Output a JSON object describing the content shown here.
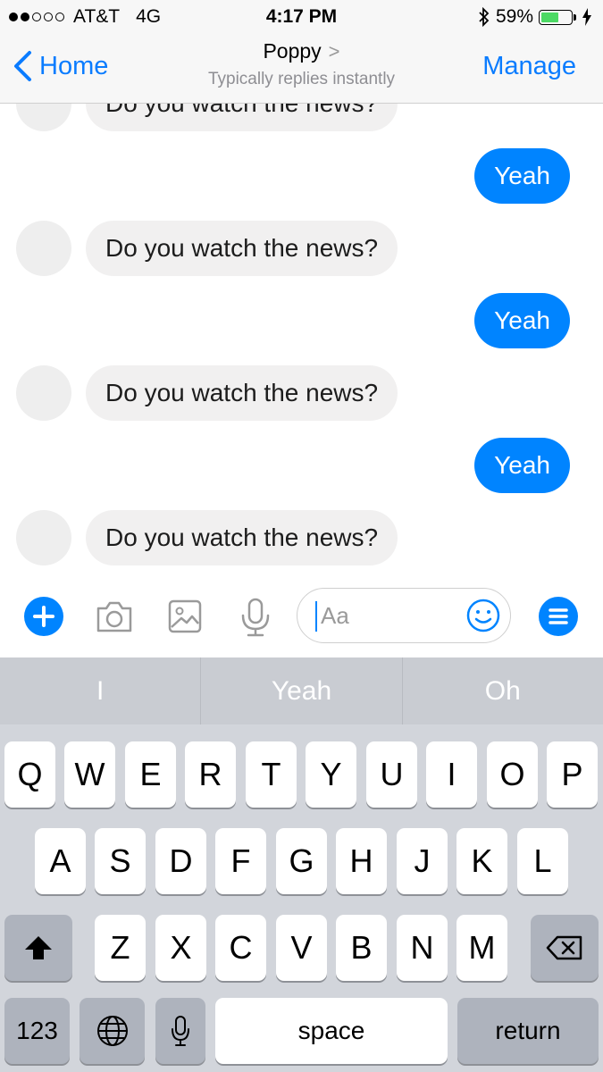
{
  "status_bar": {
    "carrier": "AT&T",
    "network": "4G",
    "time": "4:17 PM",
    "battery_percent": "59%",
    "battery_level": 0.59,
    "signal_bars": 2,
    "icons": [
      "bluetooth-icon",
      "battery-icon",
      "charging-icon"
    ]
  },
  "nav": {
    "back_label": "Home",
    "title": "Poppy",
    "subtitle": "Typically replies instantly",
    "manage_label": "Manage"
  },
  "messages": [
    {
      "from": "them",
      "text": "Do you watch the news?"
    },
    {
      "from": "me",
      "text": "Yeah"
    },
    {
      "from": "them",
      "text": "Do you watch the news?"
    },
    {
      "from": "me",
      "text": "Yeah"
    },
    {
      "from": "them",
      "text": "Do you watch the news?"
    },
    {
      "from": "me",
      "text": "Yeah"
    },
    {
      "from": "them",
      "text": "Do you watch the news?"
    }
  ],
  "composer": {
    "placeholder": "Aa",
    "icons": [
      "plus-icon",
      "camera-icon",
      "gallery-icon",
      "microphone-icon",
      "emoji-icon",
      "menu-icon"
    ],
    "accent_color": "#0084ff"
  },
  "keyboard": {
    "suggestions": [
      "I",
      "Yeah",
      "Oh"
    ],
    "row1": [
      "Q",
      "W",
      "E",
      "R",
      "T",
      "Y",
      "U",
      "I",
      "O",
      "P"
    ],
    "row2": [
      "A",
      "S",
      "D",
      "F",
      "G",
      "H",
      "J",
      "K",
      "L"
    ],
    "row3": [
      "Z",
      "X",
      "C",
      "V",
      "B",
      "N",
      "M"
    ],
    "numbers_label": "123",
    "space_label": "space",
    "return_label": "return"
  }
}
